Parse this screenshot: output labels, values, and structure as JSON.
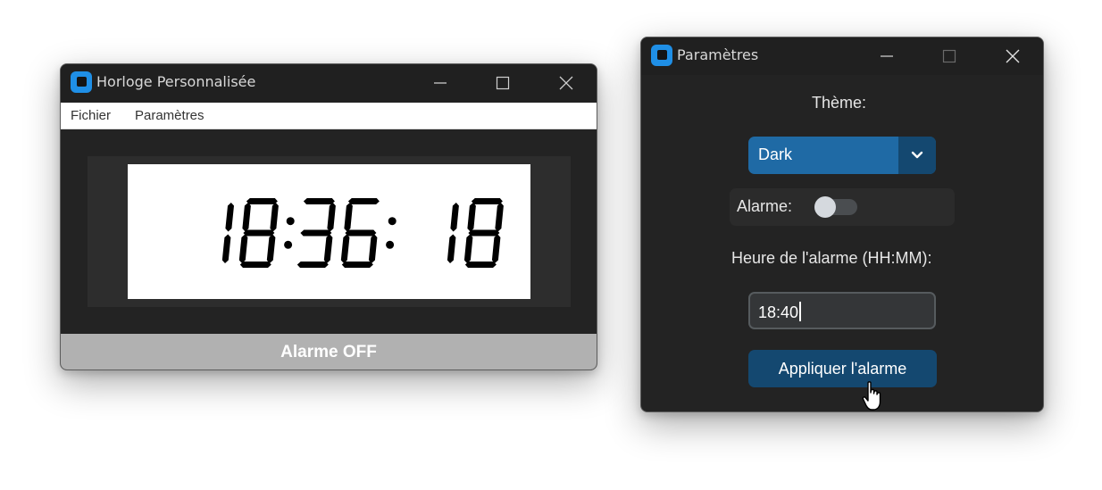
{
  "clock_window": {
    "title": "Horloge Personnalisée",
    "menu": [
      "Fichier",
      "Paramètres"
    ],
    "time": "18:36: 18",
    "status": "Alarme OFF",
    "colors": {
      "titlebar": "#202020",
      "body": "#232323",
      "status_bar": "#b1b1b1"
    }
  },
  "settings_window": {
    "title": "Paramètres",
    "theme_label": "Thème:",
    "theme_value": "Dark",
    "alarm_label": "Alarme:",
    "alarm_enabled": false,
    "alarm_time_label": "Heure de l'alarme (HH:MM):",
    "alarm_time_value": "18:40",
    "apply_label": "Appliquer l'alarme",
    "colors": {
      "accent": "#1f6aa5",
      "button": "#144870",
      "input_bg": "#343638"
    }
  },
  "icons": {
    "app": "app-icon",
    "minimize": "minimize-icon",
    "maximize": "maximize-icon",
    "close": "close-icon",
    "dropdown": "chevron-down-icon",
    "cursor": "hand-pointer-icon"
  }
}
